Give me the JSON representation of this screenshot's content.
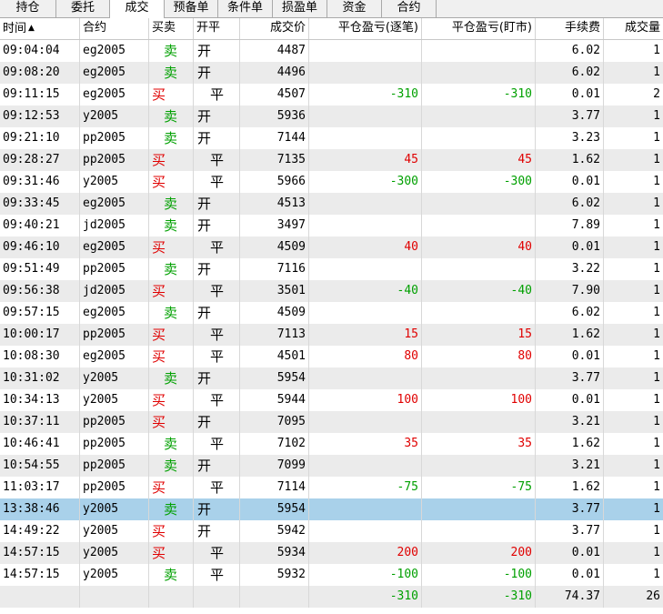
{
  "tabs": [
    {
      "label": "持仓",
      "width": 62
    },
    {
      "label": "委托",
      "width": 59
    },
    {
      "label": "成交",
      "width": 60,
      "active": true
    },
    {
      "label": "预备单",
      "width": 59
    },
    {
      "label": "条件单",
      "width": 60
    },
    {
      "label": "损盈单",
      "width": 60
    },
    {
      "label": "资金",
      "width": 60
    },
    {
      "label": "合约",
      "width": 60
    }
  ],
  "columns": [
    "时间",
    "合约",
    "买卖",
    "开平",
    "成交价",
    "平仓盈亏(逐笔)",
    "平仓盈亏(盯市)",
    "手续费",
    "成交量"
  ],
  "sort_indicator": "▲",
  "colors": {
    "buy": "#e00000",
    "sell": "#00a000",
    "selected": "#a9d1ea",
    "stripe": "#ebebeb"
  },
  "rows": [
    {
      "time": "09:04:04",
      "contract": "eg2005",
      "side": "卖",
      "oc": "开",
      "price": "4487",
      "pnl1": "",
      "pnl2": "",
      "fee": "6.02",
      "vol": "1"
    },
    {
      "time": "09:08:20",
      "contract": "eg2005",
      "side": "卖",
      "oc": "开",
      "price": "4496",
      "pnl1": "",
      "pnl2": "",
      "fee": "6.02",
      "vol": "1"
    },
    {
      "time": "09:11:15",
      "contract": "eg2005",
      "side": "买",
      "oc": "平",
      "price": "4507",
      "pnl1": "-310",
      "pnl2": "-310",
      "fee": "0.01",
      "vol": "2"
    },
    {
      "time": "09:12:53",
      "contract": "y2005",
      "side": "卖",
      "oc": "开",
      "price": "5936",
      "pnl1": "",
      "pnl2": "",
      "fee": "3.77",
      "vol": "1"
    },
    {
      "time": "09:21:10",
      "contract": "pp2005",
      "side": "卖",
      "oc": "开",
      "price": "7144",
      "pnl1": "",
      "pnl2": "",
      "fee": "3.23",
      "vol": "1"
    },
    {
      "time": "09:28:27",
      "contract": "pp2005",
      "side": "买",
      "oc": "平",
      "price": "7135",
      "pnl1": "45",
      "pnl2": "45",
      "fee": "1.62",
      "vol": "1"
    },
    {
      "time": "09:31:46",
      "contract": "y2005",
      "side": "买",
      "oc": "平",
      "price": "5966",
      "pnl1": "-300",
      "pnl2": "-300",
      "fee": "0.01",
      "vol": "1"
    },
    {
      "time": "09:33:45",
      "contract": "eg2005",
      "side": "卖",
      "oc": "开",
      "price": "4513",
      "pnl1": "",
      "pnl2": "",
      "fee": "6.02",
      "vol": "1"
    },
    {
      "time": "09:40:21",
      "contract": "jd2005",
      "side": "卖",
      "oc": "开",
      "price": "3497",
      "pnl1": "",
      "pnl2": "",
      "fee": "7.89",
      "vol": "1"
    },
    {
      "time": "09:46:10",
      "contract": "eg2005",
      "side": "买",
      "oc": "平",
      "price": "4509",
      "pnl1": "40",
      "pnl2": "40",
      "fee": "0.01",
      "vol": "1"
    },
    {
      "time": "09:51:49",
      "contract": "pp2005",
      "side": "卖",
      "oc": "开",
      "price": "7116",
      "pnl1": "",
      "pnl2": "",
      "fee": "3.22",
      "vol": "1"
    },
    {
      "time": "09:56:38",
      "contract": "jd2005",
      "side": "买",
      "oc": "平",
      "price": "3501",
      "pnl1": "-40",
      "pnl2": "-40",
      "fee": "7.90",
      "vol": "1"
    },
    {
      "time": "09:57:15",
      "contract": "eg2005",
      "side": "卖",
      "oc": "开",
      "price": "4509",
      "pnl1": "",
      "pnl2": "",
      "fee": "6.02",
      "vol": "1"
    },
    {
      "time": "10:00:17",
      "contract": "pp2005",
      "side": "买",
      "oc": "平",
      "price": "7113",
      "pnl1": "15",
      "pnl2": "15",
      "fee": "1.62",
      "vol": "1"
    },
    {
      "time": "10:08:30",
      "contract": "eg2005",
      "side": "买",
      "oc": "平",
      "price": "4501",
      "pnl1": "80",
      "pnl2": "80",
      "fee": "0.01",
      "vol": "1"
    },
    {
      "time": "10:31:02",
      "contract": "y2005",
      "side": "卖",
      "oc": "开",
      "price": "5954",
      "pnl1": "",
      "pnl2": "",
      "fee": "3.77",
      "vol": "1"
    },
    {
      "time": "10:34:13",
      "contract": "y2005",
      "side": "买",
      "oc": "平",
      "price": "5944",
      "pnl1": "100",
      "pnl2": "100",
      "fee": "0.01",
      "vol": "1"
    },
    {
      "time": "10:37:11",
      "contract": "pp2005",
      "side": "买",
      "oc": "开",
      "price": "7095",
      "pnl1": "",
      "pnl2": "",
      "fee": "3.21",
      "vol": "1"
    },
    {
      "time": "10:46:41",
      "contract": "pp2005",
      "side": "卖",
      "oc": "平",
      "price": "7102",
      "pnl1": "35",
      "pnl2": "35",
      "fee": "1.62",
      "vol": "1"
    },
    {
      "time": "10:54:55",
      "contract": "pp2005",
      "side": "卖",
      "oc": "开",
      "price": "7099",
      "pnl1": "",
      "pnl2": "",
      "fee": "3.21",
      "vol": "1"
    },
    {
      "time": "11:03:17",
      "contract": "pp2005",
      "side": "买",
      "oc": "平",
      "price": "7114",
      "pnl1": "-75",
      "pnl2": "-75",
      "fee": "1.62",
      "vol": "1"
    },
    {
      "time": "13:38:46",
      "contract": "y2005",
      "side": "卖",
      "oc": "开",
      "price": "5954",
      "pnl1": "",
      "pnl2": "",
      "fee": "3.77",
      "vol": "1",
      "selected": true
    },
    {
      "time": "14:49:22",
      "contract": "y2005",
      "side": "买",
      "oc": "开",
      "price": "5942",
      "pnl1": "",
      "pnl2": "",
      "fee": "3.77",
      "vol": "1"
    },
    {
      "time": "14:57:15",
      "contract": "y2005",
      "side": "买",
      "oc": "平",
      "price": "5934",
      "pnl1": "200",
      "pnl2": "200",
      "fee": "0.01",
      "vol": "1"
    },
    {
      "time": "14:57:15",
      "contract": "y2005",
      "side": "卖",
      "oc": "平",
      "price": "5932",
      "pnl1": "-100",
      "pnl2": "-100",
      "fee": "0.01",
      "vol": "1"
    }
  ],
  "total": {
    "pnl1": "-310",
    "pnl2": "-310",
    "fee": "74.37",
    "vol": "26"
  }
}
